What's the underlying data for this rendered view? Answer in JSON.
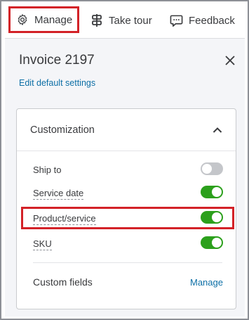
{
  "toolbar": {
    "manage_label": "Manage",
    "tour_label": "Take tour",
    "feedback_label": "Feedback"
  },
  "panel": {
    "title": "Invoice 2197",
    "edit_link": "Edit default settings"
  },
  "customization": {
    "heading": "Customization",
    "options": [
      {
        "label": "Ship to",
        "on": false
      },
      {
        "label": "Service date",
        "on": true
      },
      {
        "label": "Product/service",
        "on": true
      },
      {
        "label": "SKU",
        "on": true
      }
    ],
    "custom_fields_label": "Custom fields",
    "custom_fields_link": "Manage"
  },
  "colors": {
    "toggle_on": "#2ca01c",
    "toggle_off": "#c4c6ca",
    "link": "#0d6fa6",
    "highlight": "#d32228"
  },
  "icons": {
    "manage": "gear-icon",
    "tour": "signpost-icon",
    "feedback": "speech-bubble-icon",
    "close": "close-icon",
    "collapse": "chevron-up-icon"
  }
}
